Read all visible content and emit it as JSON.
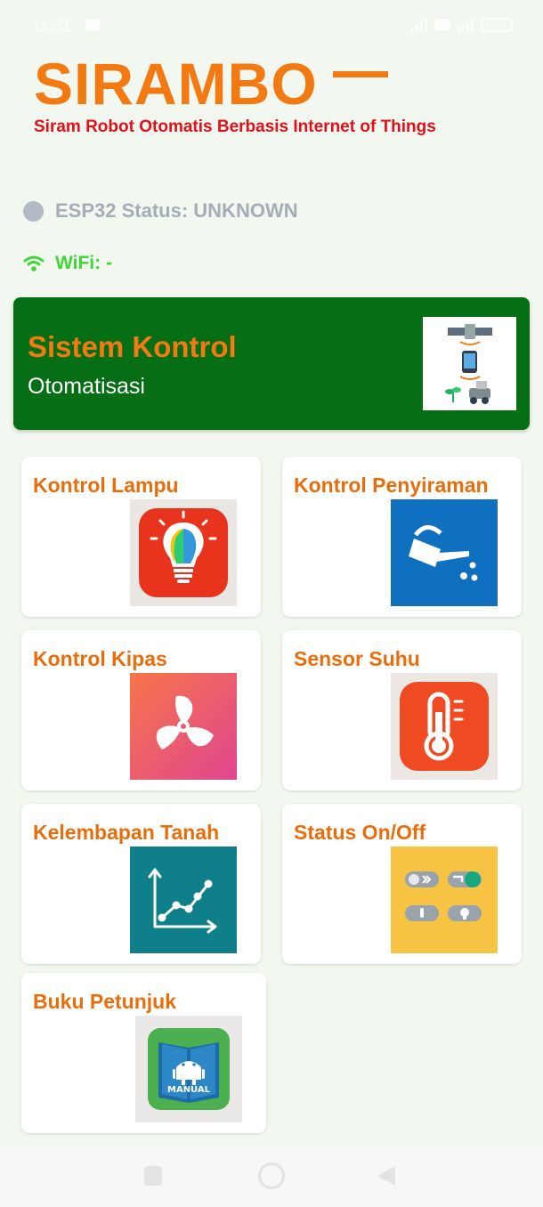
{
  "status_bar": {
    "time": "11:31",
    "battery_label": "100"
  },
  "header": {
    "title": "SIRAMBO",
    "subtitle": "Siram Robot Otomatis Berbasis Internet of Things",
    "accent_color": "#f37a12",
    "subtitle_color": "#e0111a"
  },
  "status": {
    "esp_label": "ESP32 Status: UNKNOWN",
    "wifi_label": "WiFi: -"
  },
  "hero": {
    "title": "Sistem Kontrol",
    "subtitle": "Otomatisasi",
    "background": "#066e14",
    "icon": "satellite-phone-robot-illustration"
  },
  "menu": [
    {
      "label": "Kontrol Lampu",
      "icon": "lightbulb-icon",
      "icon_bg": "#e9e6e4"
    },
    {
      "label": "Kontrol Penyiraman",
      "icon": "watering-can-icon",
      "icon_bg": "#0f70c0"
    },
    {
      "label": "Kontrol Kipas",
      "icon": "fan-icon",
      "icon_bg": "#f0606e"
    },
    {
      "label": "Sensor Suhu",
      "icon": "thermometer-icon",
      "icon_bg": "#ece7e3"
    },
    {
      "label": "Kelembapan Tanah",
      "icon": "line-chart-icon",
      "icon_bg": "#0f7f8a"
    },
    {
      "label": "Status On/Off",
      "icon": "toggle-switches-icon",
      "icon_bg": "#f6c343"
    },
    {
      "label": "Buku Petunjuk",
      "icon": "manual-book-icon",
      "icon_bg": "#ebe9e7",
      "badge": "MANUAL"
    }
  ]
}
